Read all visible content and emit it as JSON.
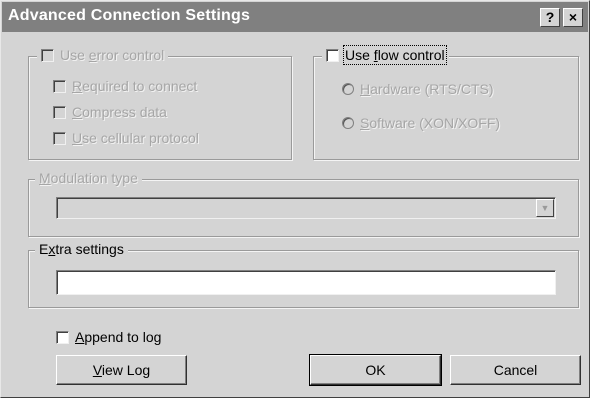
{
  "window": {
    "title": "Advanced Connection Settings",
    "help_label": "?",
    "close_label": "×"
  },
  "error_control": {
    "legend": {
      "pre": "Use ",
      "key": "e",
      "post": "rror control"
    },
    "checked": false,
    "enabled": false,
    "options": [
      {
        "pre": "",
        "key": "R",
        "post": "equired to connect",
        "checked": false
      },
      {
        "pre": "",
        "key": "C",
        "post": "ompress data",
        "checked": false
      },
      {
        "pre": "",
        "key": "U",
        "post": "se cellular protocol",
        "checked": false
      }
    ]
  },
  "flow_control": {
    "legend": {
      "pre": "Use ",
      "key": "f",
      "post": "low control"
    },
    "checked": false,
    "enabled": true,
    "options": [
      {
        "pre": "",
        "key": "H",
        "post": "ardware (RTS/CTS)",
        "selected": false
      },
      {
        "pre": "",
        "key": "S",
        "post": "oftware (XON/XOFF)",
        "selected": false
      }
    ]
  },
  "modulation": {
    "legend": {
      "pre": "",
      "key": "M",
      "post": "odulation type"
    },
    "value": "",
    "enabled": false
  },
  "extra": {
    "legend": {
      "pre": "E",
      "key": "x",
      "post": "tra settings"
    },
    "value": ""
  },
  "append_log": {
    "label": {
      "pre": "",
      "key": "A",
      "post": "ppend to log"
    },
    "checked": false
  },
  "buttons": {
    "view_log": {
      "pre": "",
      "key": "V",
      "post": "iew Log"
    },
    "ok": "OK",
    "cancel": "Cancel"
  },
  "colors": {
    "face": "#d4d4d4",
    "title_bar": "#808080",
    "disabled_text": "#a6a6a6"
  }
}
